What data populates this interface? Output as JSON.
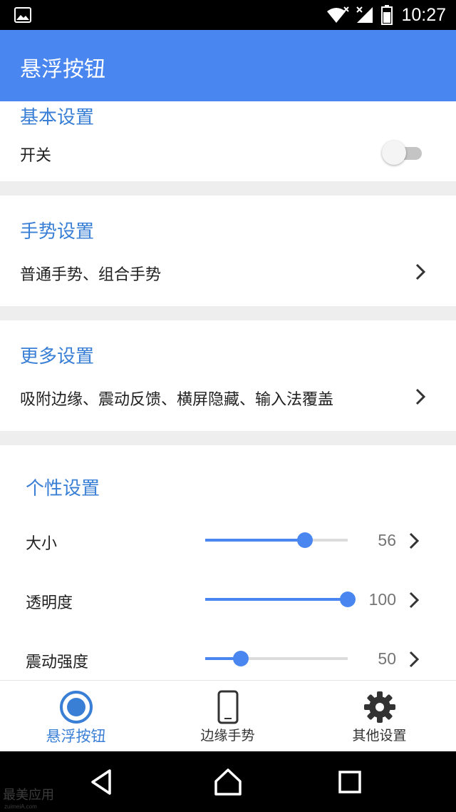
{
  "status_bar": {
    "time": "10:27",
    "icons": [
      "image-icon",
      "wifi-icon",
      "signal-icon",
      "battery-icon"
    ]
  },
  "app_bar": {
    "title": "悬浮按钮"
  },
  "sections": {
    "basic": {
      "title": "基本设置",
      "switch_label": "开关",
      "switch_on": false
    },
    "gesture": {
      "title": "手势设置",
      "summary": "普通手势、组合手势"
    },
    "more": {
      "title": "更多设置",
      "summary": "吸附边缘、震动反馈、横屏隐藏、输入法覆盖"
    },
    "personal": {
      "title": "个性设置",
      "sliders": [
        {
          "label": "大小",
          "value": "56",
          "fraction": 0.7
        },
        {
          "label": "透明度",
          "value": "100",
          "fraction": 1.0
        },
        {
          "label": "震动强度",
          "value": "50",
          "fraction": 0.25
        }
      ]
    }
  },
  "bottom_nav": {
    "items": [
      {
        "label": "悬浮按钮",
        "icon": "target-circle-icon",
        "active": true
      },
      {
        "label": "边缘手势",
        "icon": "phone-icon",
        "active": false
      },
      {
        "label": "其他设置",
        "icon": "gear-icon",
        "active": false
      }
    ]
  },
  "system_nav": {
    "buttons": [
      "back-icon",
      "home-icon",
      "recents-icon"
    ]
  },
  "watermark": {
    "text": "最美应用",
    "sub": "zuimeiA.com"
  },
  "colors": {
    "accent": "#4a86f0",
    "section_title": "#3a7fd6",
    "divider_bg": "#eeeeee"
  }
}
